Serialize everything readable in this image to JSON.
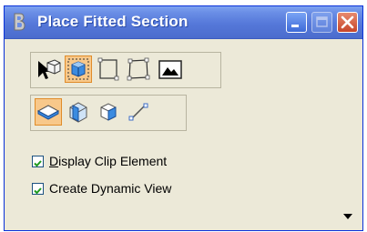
{
  "window": {
    "title": "Place Fitted Section",
    "title_icon": "bentley-b-icon",
    "minimize_icon": "minimize-icon",
    "maximize_icon": "maximize-icon",
    "close_icon": "close-icon"
  },
  "toolbar1": {
    "tools": [
      {
        "icon": "select-element-icon",
        "active": false
      },
      {
        "icon": "fitted-section-icon",
        "active": true
      },
      {
        "icon": "rectangle-icon",
        "active": false
      },
      {
        "icon": "polygon-icon",
        "active": false
      },
      {
        "icon": "image-icon",
        "active": false
      }
    ]
  },
  "toolbar2": {
    "tools": [
      {
        "icon": "plane-icon",
        "active": true
      },
      {
        "icon": "volume-icon",
        "active": false
      },
      {
        "icon": "cube-icon",
        "active": false
      },
      {
        "icon": "line-icon",
        "active": false
      }
    ]
  },
  "options": [
    {
      "mnemonic": "D",
      "label_rest": "isplay Clip Element",
      "checked": true
    },
    {
      "mnemonic": "",
      "label_rest": "Create Dynamic View",
      "checked": true
    }
  ],
  "colors": {
    "title_bar": "#5578d9",
    "active_tool": "#f8c88a",
    "dialog_bg": "#ece9d8",
    "checkmark": "#1e9a1e"
  }
}
